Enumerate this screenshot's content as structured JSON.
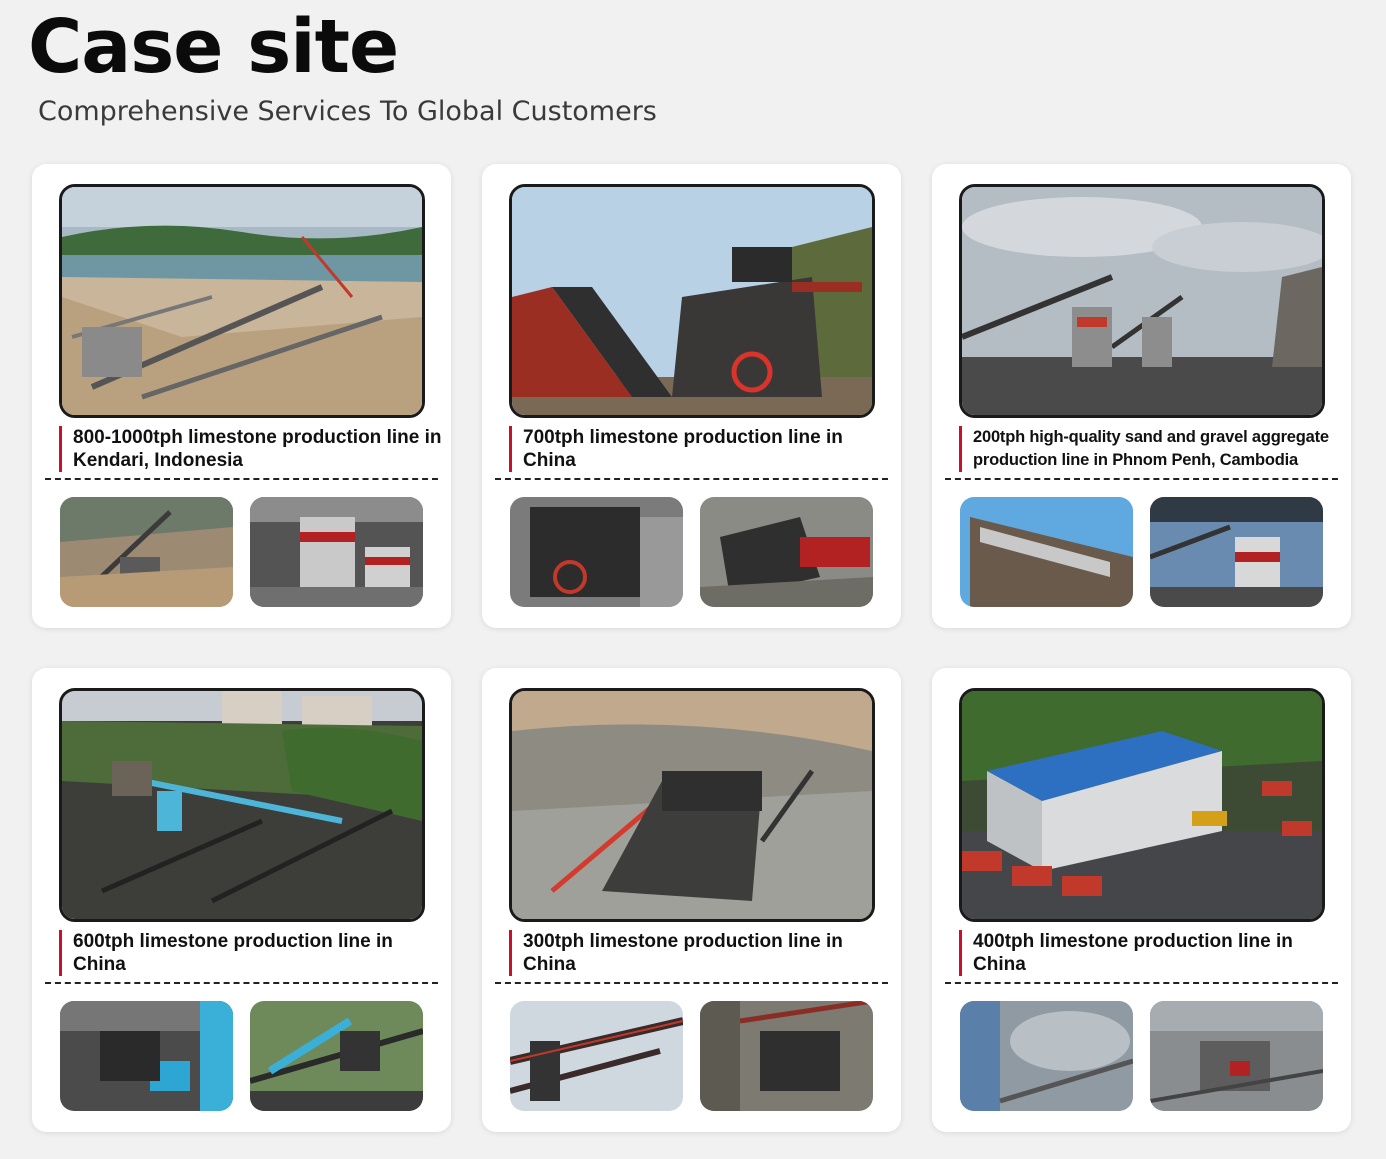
{
  "header": {
    "title": "Case site",
    "subtitle": "Comprehensive Services To Global Customers"
  },
  "cases": [
    {
      "caption": "800-1000tph limestone production line in Kendari, Indonesia",
      "photo_description": "open-pit quarry with conveyor belts beside a bay",
      "thumbs": [
        "quarry conveyor line",
        "cone crusher plant"
      ]
    },
    {
      "caption": "700tph limestone production line in China",
      "photo_description": "impact crusher with feeding conveyor",
      "thumbs": [
        "impact crusher close-up",
        "crusher on quarry slope"
      ]
    },
    {
      "caption": "200tph high-quality sand and gravel aggregate production line in Phnom Penh, Cambodia",
      "photo_description": "sand making plant with conveyors under cloudy sky",
      "thumbs": [
        "vibrating screen",
        "sand making machine"
      ]
    },
    {
      "caption": "600tph limestone production line in China",
      "photo_description": "hillside crushing plant with blue pipes near city",
      "thumbs": [
        "blue feeder and crusher",
        "conveyor with blue pipe"
      ]
    },
    {
      "caption": "300tph limestone production line in China",
      "photo_description": "mobile crushing station with red-rail conveyors",
      "thumbs": [
        "conveyor gantries",
        "jaw crusher unit"
      ]
    },
    {
      "caption": "400tph limestone production line in China",
      "photo_description": "large enclosed factory with blue roof and red trucks",
      "thumbs": [
        "dusty enclosed conveyor hall",
        "indoor crusher"
      ]
    }
  ],
  "colors": {
    "accent": "#c8102e",
    "background": "#f1f1f1",
    "card": "#ffffff"
  }
}
